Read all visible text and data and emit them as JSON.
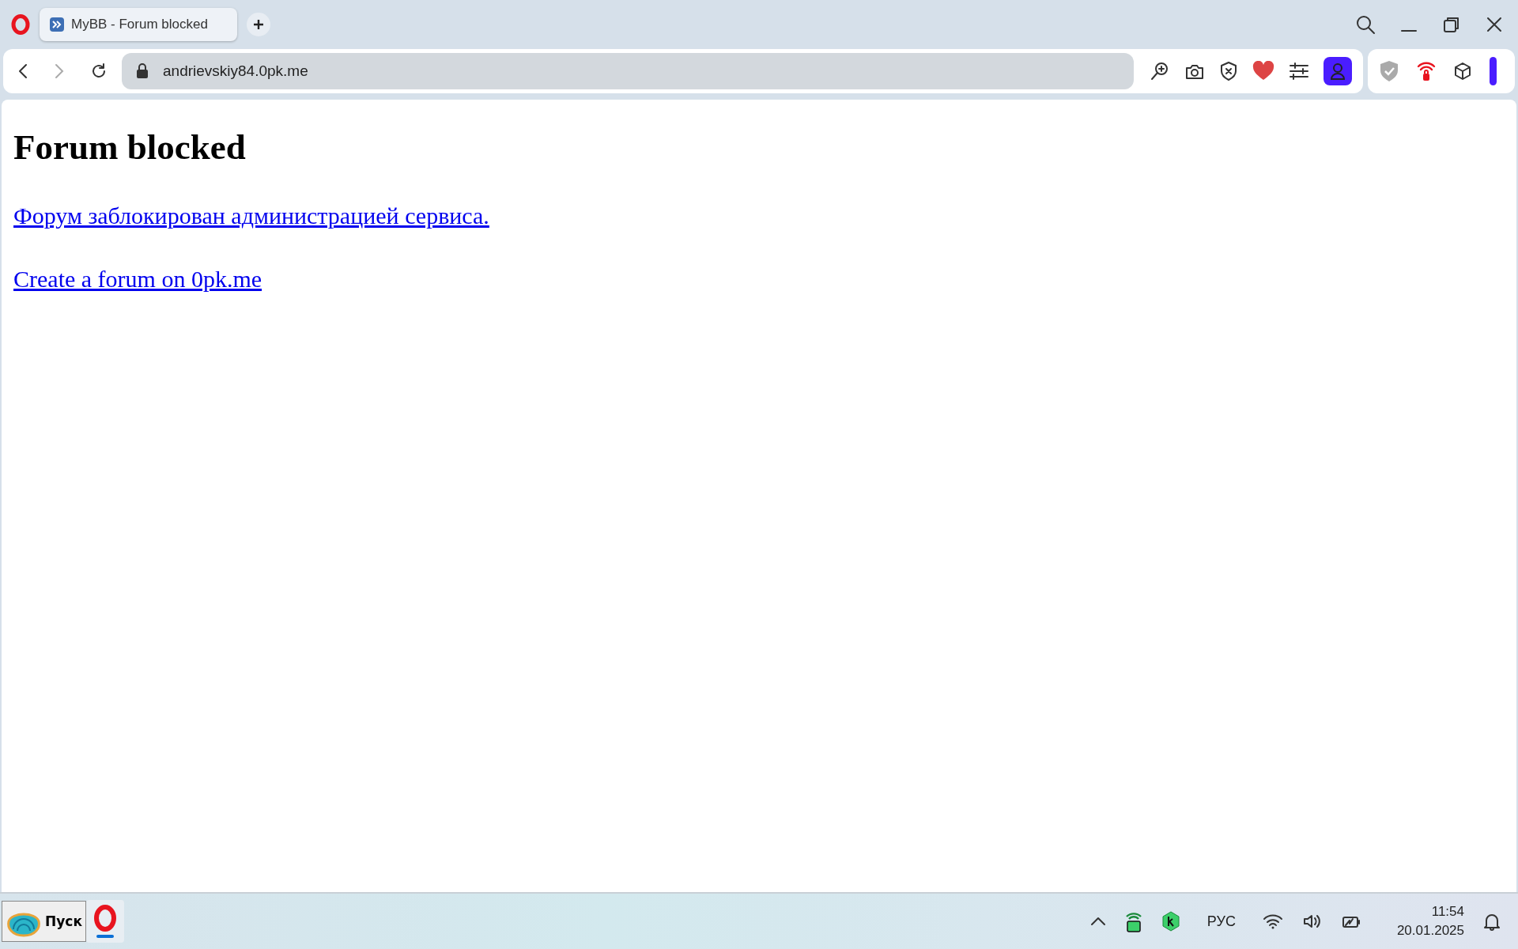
{
  "tabs": [
    {
      "title": "MyBB - Forum blocked",
      "selected": true
    }
  ],
  "address_bar": {
    "url": "andrievskiy84.0pk.me"
  },
  "page": {
    "heading": "Forum blocked",
    "links": [
      "Форум заблокирован администрацией сервиса.",
      "Create a forum on 0pk.me"
    ]
  },
  "taskbar": {
    "start_label": "Пуск",
    "language": "РУС",
    "time": "11:54",
    "date": "20.01.2025"
  }
}
